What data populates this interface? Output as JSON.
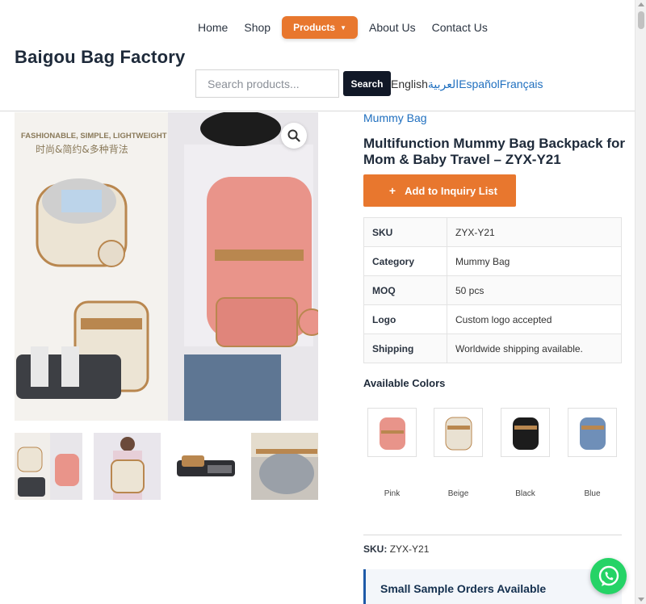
{
  "site": {
    "logo_text": "Baigou Bag Factory"
  },
  "nav": {
    "items": [
      {
        "label": "Home"
      },
      {
        "label": "Shop"
      },
      {
        "label": "Products",
        "active": true
      },
      {
        "label": "About Us"
      },
      {
        "label": "Contact Us"
      }
    ]
  },
  "search": {
    "placeholder": "Search products...",
    "value": "",
    "button_label": "Search"
  },
  "languages": [
    {
      "label": "English",
      "current": true
    },
    {
      "label": "العربية"
    },
    {
      "label": "Español"
    },
    {
      "label": "Français"
    }
  ],
  "gallery": {
    "main_overlay_text": {
      "en": "FASHIONABLE, SIMPLE, LIGHTWEIGHT",
      "zh": "时尚&简约&多种背法"
    },
    "zoom_icon": "magnifier-icon",
    "thumbnails": [
      "thumbnail-1",
      "thumbnail-2",
      "thumbnail-3",
      "thumbnail-4"
    ]
  },
  "product": {
    "category_link": "Mummy Bag",
    "title": "Multifunction Mummy Bag Backpack for Mom & Baby Travel – ZYX-Y21",
    "inquiry_button": {
      "icon": "plus-icon",
      "plus": "+",
      "label": "Add to Inquiry List"
    },
    "specs": [
      {
        "key": "SKU",
        "value": "ZYX-Y21"
      },
      {
        "key": "Category",
        "value": "Mummy Bag"
      },
      {
        "key": "MOQ",
        "value": "50 pcs"
      },
      {
        "key": "Logo",
        "value": "Custom logo accepted"
      },
      {
        "key": "Shipping",
        "value": "Worldwide shipping available."
      }
    ],
    "colors_heading": "Available Colors",
    "colors": [
      {
        "label": "Pink",
        "color": "#e8948a"
      },
      {
        "label": "Beige",
        "color": "#e9e1d2"
      },
      {
        "label": "Black",
        "color": "#1c1c1c"
      },
      {
        "label": "Blue",
        "color": "#6f8fb8"
      }
    ],
    "sku_line": {
      "label": "SKU:",
      "value": "ZYX-Y21"
    },
    "notice_title": "Small Sample Orders Available"
  },
  "theme": {
    "accent": "#e8772e",
    "link": "#1f6fbf",
    "dark": "#111827",
    "whatsapp": "#25d366"
  },
  "floating": {
    "whatsapp_icon": "whatsapp-icon"
  }
}
